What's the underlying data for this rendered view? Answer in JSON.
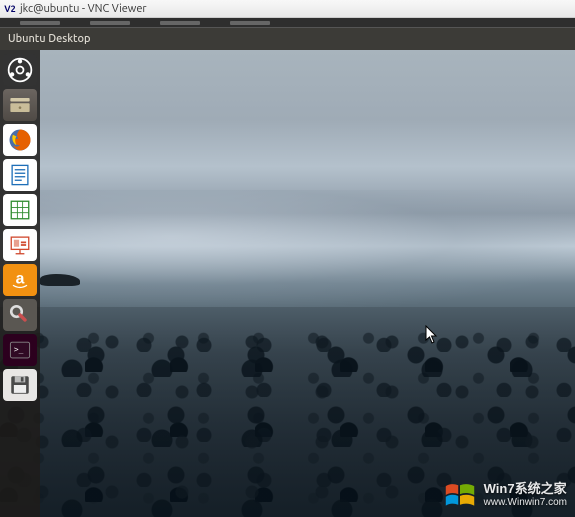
{
  "vnc": {
    "logo": "V2",
    "title": "jkc@ubuntu - VNC Viewer"
  },
  "panel": {
    "title": "Ubuntu Desktop"
  },
  "launcher": {
    "items": [
      {
        "name": "dash",
        "label": "Dash"
      },
      {
        "name": "files",
        "label": "Files"
      },
      {
        "name": "firefox",
        "label": "Firefox Web Browser"
      },
      {
        "name": "writer",
        "label": "LibreOffice Writer"
      },
      {
        "name": "calc",
        "label": "LibreOffice Calc"
      },
      {
        "name": "impress",
        "label": "LibreOffice Impress"
      },
      {
        "name": "amazon",
        "label": "Amazon"
      },
      {
        "name": "settings",
        "label": "System Settings"
      },
      {
        "name": "terminal",
        "label": "Terminal"
      },
      {
        "name": "save",
        "label": "Save / Disk"
      }
    ]
  },
  "watermark": {
    "line1": "Win7系统之家",
    "line2": "www.Winwin7.com"
  }
}
